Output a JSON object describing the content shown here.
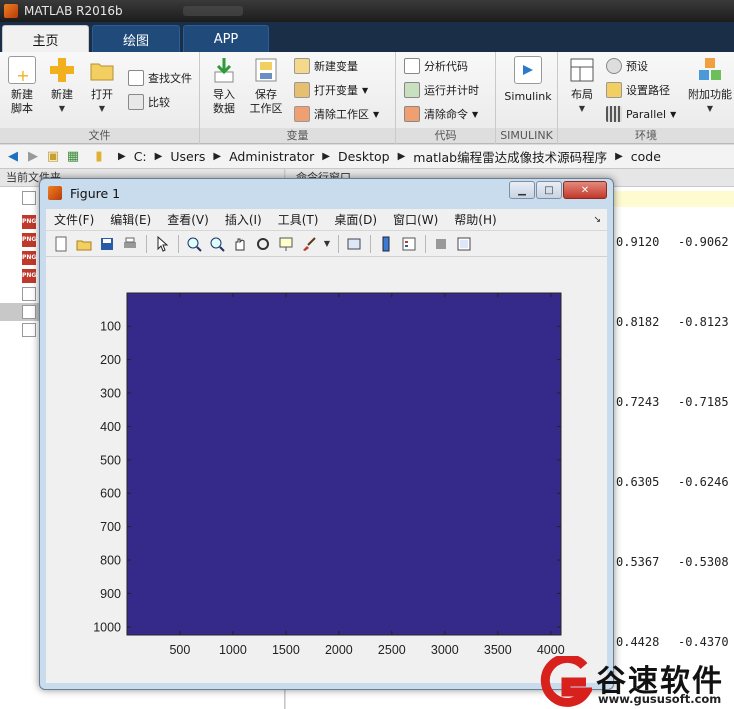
{
  "app": {
    "title": "MATLAB R2016b"
  },
  "tabs": [
    {
      "label": "主页"
    },
    {
      "label": "绘图"
    },
    {
      "label": "APP"
    }
  ],
  "ribbon": {
    "file": {
      "label": "文件",
      "new_script": "新建\n脚本",
      "new": "新建",
      "open": "打开",
      "find_files": "查找文件",
      "compare": "比较"
    },
    "variable": {
      "label": "变量",
      "import": "导入\n数据",
      "save_ws": "保存\n工作区",
      "new_var": "新建变量",
      "open_var": "打开变量",
      "clear_ws": "清除工作区"
    },
    "code": {
      "label": "代码",
      "analyze": "分析代码",
      "run_time": "运行并计时",
      "clear_cmds": "清除命令"
    },
    "simulink": {
      "label": "SIMULINK",
      "btn": "Simulink"
    },
    "environment": {
      "label": "环境",
      "layout": "布局",
      "prefs": "预设",
      "set_path": "设置路径",
      "parallel": "Parallel",
      "addons": "附加功能"
    }
  },
  "address": {
    "crumbs": [
      "C:",
      "Users",
      "Administrator",
      "Desktop",
      "matlab编程雷达成像技术源码程序",
      "code"
    ]
  },
  "panels": {
    "current_folder": "当前文件夹",
    "command_window": "命令行窗口",
    "col1": [
      "0.9120",
      "0.8182",
      "0.7243",
      "0.6305",
      "0.5367",
      "0.4428"
    ],
    "col2": [
      "-0.9062",
      "-0.8123",
      "-0.7185",
      "-0.6246",
      "-0.5308",
      "-0.4370"
    ]
  },
  "figure": {
    "title": "Figure 1",
    "menus": [
      "文件(F)",
      "编辑(E)",
      "查看(V)",
      "插入(I)",
      "工具(T)",
      "桌面(D)",
      "窗口(W)",
      "帮助(H)"
    ]
  },
  "chart_data": {
    "type": "heatmap",
    "title": "",
    "xlabel": "",
    "ylabel": "",
    "x_ticks": [
      500,
      1000,
      1500,
      2000,
      2500,
      3000,
      3500,
      4000
    ],
    "y_ticks": [
      100,
      200,
      300,
      400,
      500,
      600,
      700,
      800,
      900,
      1000
    ],
    "xlim": [
      0.5,
      4096.5
    ],
    "ylim": [
      0.5,
      1024.5
    ],
    "y_reversed": true,
    "fill_color": "#35298a"
  },
  "watermark": {
    "text": "谷速软件",
    "url": "www.gususoft.com"
  }
}
